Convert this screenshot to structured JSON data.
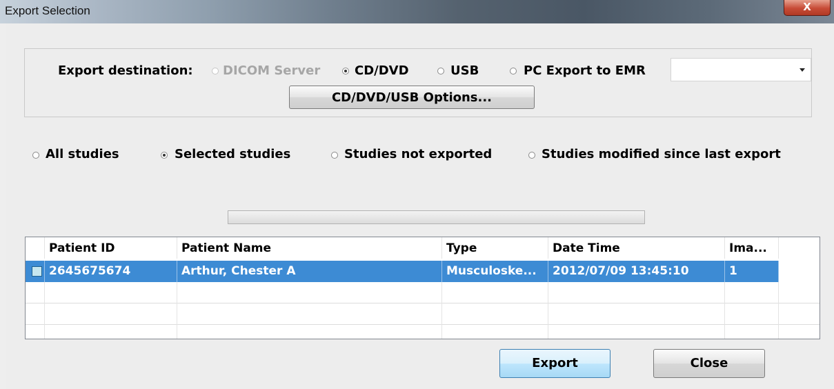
{
  "window": {
    "title": "Export Selection",
    "close_label": "X"
  },
  "destination": {
    "label": "Export destination:",
    "options": [
      {
        "label": "DICOM Server",
        "selected": false,
        "enabled": false
      },
      {
        "label": "CD/DVD",
        "selected": true,
        "enabled": true
      },
      {
        "label": "USB",
        "selected": false,
        "enabled": true
      },
      {
        "label": "PC Export to EMR",
        "selected": false,
        "enabled": true
      }
    ],
    "combo_value": "",
    "options_button": "CD/DVD/USB Options..."
  },
  "scope": {
    "options": [
      {
        "label": "All studies",
        "selected": false
      },
      {
        "label": "Selected studies",
        "selected": true
      },
      {
        "label": "Studies not exported",
        "selected": false
      },
      {
        "label": "Studies modified since last export",
        "selected": false
      }
    ]
  },
  "table": {
    "columns": [
      "Patient ID",
      "Patient Name",
      "Type",
      "Date Time",
      "Ima..."
    ],
    "rows": [
      {
        "checked": false,
        "patient_id": "2645675674",
        "patient_name": "Arthur, Chester A",
        "type": "Musculoske...",
        "date_time": "2012/07/09 13:45:10",
        "images": "1"
      }
    ]
  },
  "buttons": {
    "export": "Export",
    "close": "Close"
  },
  "colors": {
    "selection": "#3d8bd4",
    "default_button_border": "#3c7fb1"
  }
}
